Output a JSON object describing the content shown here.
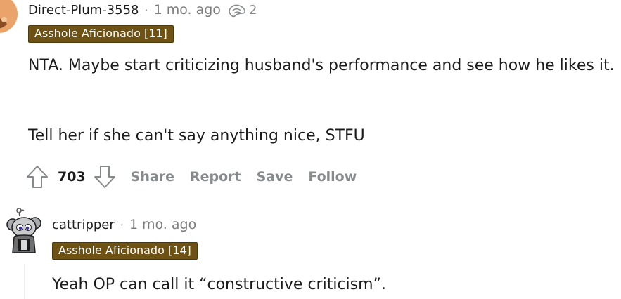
{
  "comments": [
    {
      "username": "Direct-Plum-3558",
      "separator": "·",
      "time": "1 mo. ago",
      "award_icon": "award-icon",
      "award_count": "2",
      "flair": "Asshole Aficionado [11]",
      "paragraphs": [
        "NTA. Maybe start criticizing husband's performance and see how he likes it.",
        "Tell her if she can't say anything nice, STFU"
      ],
      "score": "703",
      "actions": [
        "Share",
        "Report",
        "Save",
        "Follow"
      ]
    },
    {
      "username": "cattripper",
      "separator": "·",
      "time": "1 mo. ago",
      "flair": "Asshole Aficionado [14]",
      "paragraphs": [
        "Yeah OP can call it “constructive criticism”."
      ]
    }
  ],
  "colors": {
    "flair_bg": "#6e5214",
    "meta_gray": "#878a8c",
    "text": "#1c1c1c",
    "avatar1": "#e4a06a"
  }
}
